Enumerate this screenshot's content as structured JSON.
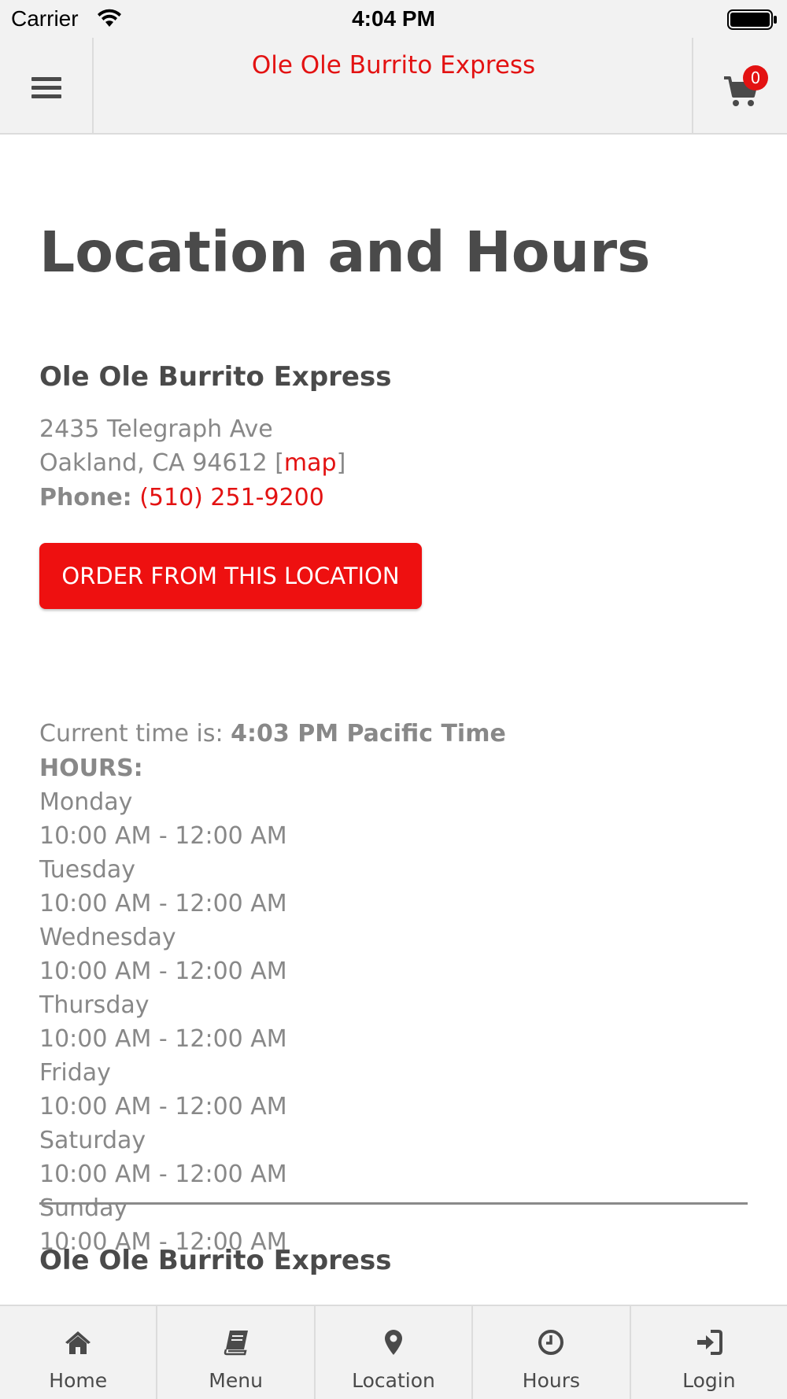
{
  "status_bar": {
    "carrier": "Carrier",
    "time": "4:04 PM"
  },
  "header": {
    "title": "Ole Ole Burrito Express",
    "cart_count": "0"
  },
  "page": {
    "title": "Location and Hours"
  },
  "location": {
    "name": "Ole Ole Burrito Express",
    "address_line1": "2435 Telegraph Ave",
    "address_line2": "Oakland, CA 94612 [",
    "map_link": "map",
    "address_line2_end": "]",
    "phone_label": "Phone:",
    "phone": "(510) 251-9200",
    "order_button": "ORDER FROM THIS LOCATION",
    "current_time_label": "Current time is:",
    "current_time": "4:03 PM Pacific Time",
    "hours_label": "HOURS:",
    "hours": [
      {
        "day": "Monday",
        "time": "10:00 AM - 12:00 AM"
      },
      {
        "day": "Tuesday",
        "time": "10:00 AM - 12:00 AM"
      },
      {
        "day": "Wednesday",
        "time": "10:00 AM - 12:00 AM"
      },
      {
        "day": "Thursday",
        "time": "10:00 AM - 12:00 AM"
      },
      {
        "day": "Friday",
        "time": "10:00 AM - 12:00 AM"
      },
      {
        "day": "Saturday",
        "time": "10:00 AM - 12:00 AM"
      },
      {
        "day": "Sunday",
        "time": "10:00 AM - 12:00 AM"
      }
    ]
  },
  "second_location": {
    "name": "Ole Ole Burrito Express"
  },
  "bottom_nav": {
    "items": [
      {
        "label": "Home",
        "icon": "home-icon"
      },
      {
        "label": "Menu",
        "icon": "book-icon"
      },
      {
        "label": "Location",
        "icon": "map-marker-icon"
      },
      {
        "label": "Hours",
        "icon": "clock-icon"
      },
      {
        "label": "Login",
        "icon": "sign-in-icon"
      }
    ]
  },
  "colors": {
    "brand_red": "#e31212",
    "text_dark": "#4a4a4a",
    "text_muted": "#888888",
    "bar_background": "#f2f2f2"
  }
}
